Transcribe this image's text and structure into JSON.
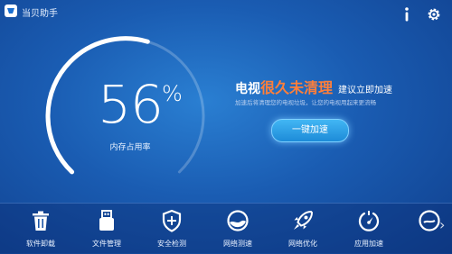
{
  "app": {
    "title": "当贝助手"
  },
  "top_icons": [
    "info-icon",
    "gear-icon"
  ],
  "memory": {
    "percent": "56",
    "percent_sign": "%",
    "label": "内存占用率",
    "fraction": 0.56
  },
  "message": {
    "prefix": "电视",
    "highlight": "很久未清理",
    "suffix": "建议立即加速",
    "description": "加速后将清理您的电视垃圾，让您的电视用起来更流畅"
  },
  "action": {
    "clean_label": "一键加速"
  },
  "tools": [
    {
      "label": "软件卸载",
      "icon": "trash-icon"
    },
    {
      "label": "文件管理",
      "icon": "usb-icon"
    },
    {
      "label": "安全检测",
      "icon": "shield-plus-icon"
    },
    {
      "label": "网络测速",
      "icon": "speed-globe-icon"
    },
    {
      "label": "网络优化",
      "icon": "rocket-icon"
    },
    {
      "label": "应用加速",
      "icon": "gauge-icon"
    }
  ],
  "colors": {
    "accent": "#ff7f3a",
    "button": "#2ba3ea",
    "background": "#1a5cb2"
  }
}
